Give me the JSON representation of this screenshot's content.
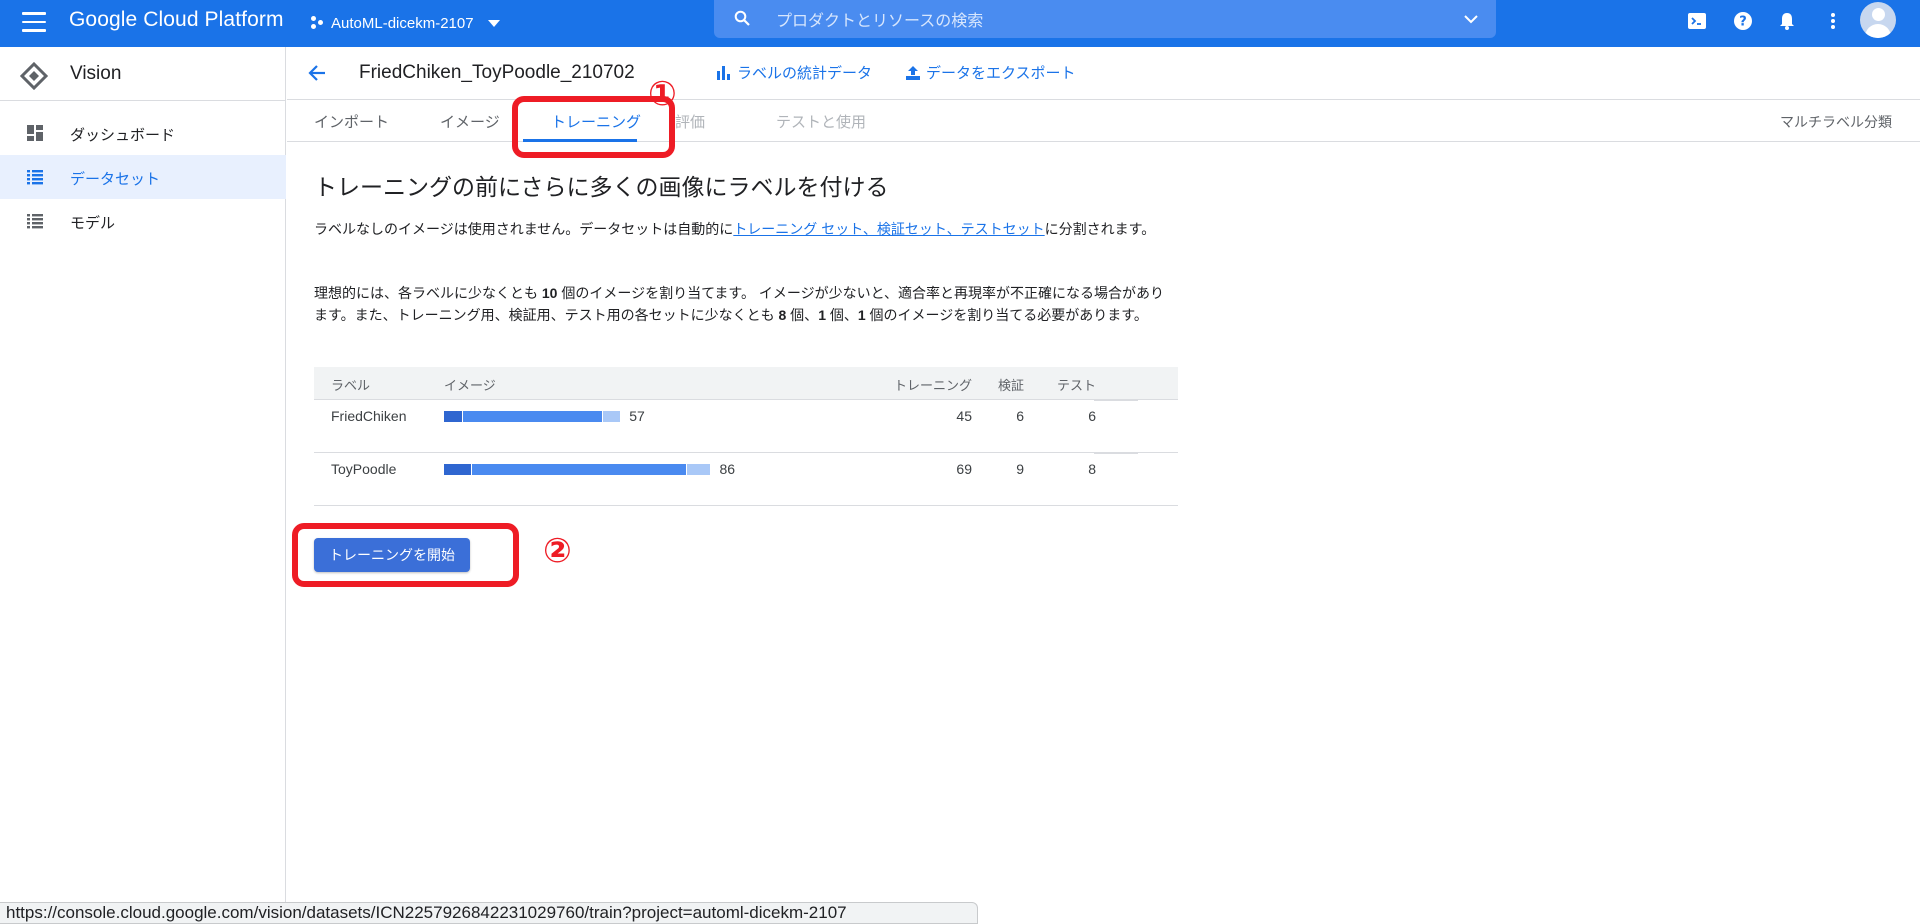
{
  "topbar": {
    "brand": "Google Cloud Platform",
    "project": "AutoML-dicekm-2107",
    "search_placeholder": "プロダクトとリソースの検索"
  },
  "sidebar": {
    "title": "Vision",
    "items": [
      {
        "label": "ダッシュボード",
        "active": false
      },
      {
        "label": "データセット",
        "active": true
      },
      {
        "label": "モデル",
        "active": false
      }
    ]
  },
  "header": {
    "dataset_title": "FriedChiken_ToyPoodle_210702",
    "label_stats": "ラベルの統計データ",
    "export": "データをエクスポート"
  },
  "tabs": [
    {
      "label": "インポート",
      "state": "normal"
    },
    {
      "label": "イメージ",
      "state": "normal"
    },
    {
      "label": "トレーニング",
      "state": "active"
    },
    {
      "label": "評価",
      "state": "disabled"
    },
    {
      "label": "テストと使用",
      "state": "disabled"
    }
  ],
  "classification_type": "マルチラベル分類",
  "annotations": {
    "one": "①",
    "two": "②"
  },
  "content": {
    "title": "トレーニングの前にさらに多くの画像にラベルを付ける",
    "para1_prefix": "ラベルなしのイメージは使用されません。データセットは自動的に",
    "para1_link": "トレーニング セット、検証セット、テストセット",
    "para1_suffix": "に分割されます。",
    "para2_a": "理想的には、各ラベルに少なくとも ",
    "para2_b": "10",
    "para2_c": " 個のイメージを割り当てます。 イメージが少ないと、適合率と再現率が不正確になる場合があります。また、トレーニング用、検証用、テスト用の各セットに少なくとも ",
    "para2_d": "8",
    "para2_e": " 個、",
    "para2_f": "1",
    "para2_g": " 個、",
    "para2_h": "1",
    "para2_i": " 個のイメージを割り当てる必要があります。"
  },
  "table": {
    "headers": {
      "label": "ラベル",
      "images": "イメージ",
      "train": "トレーニング",
      "validation": "検証",
      "test": "テスト"
    },
    "rows": [
      {
        "label": "FriedChiken",
        "images": 57,
        "train": 45,
        "validation": 6,
        "test": 6
      },
      {
        "label": "ToyPoodle",
        "images": 86,
        "train": 69,
        "validation": 9,
        "test": 8
      }
    ],
    "colors": {
      "validation": "#2f66d0",
      "train": "#4a8af0",
      "test": "#a9c8f7"
    }
  },
  "start_button": "トレーニングを開始",
  "status_url": "https://console.cloud.google.com/vision/datasets/ICN2257926842231029760/train?project=automl-dicekm-2107"
}
